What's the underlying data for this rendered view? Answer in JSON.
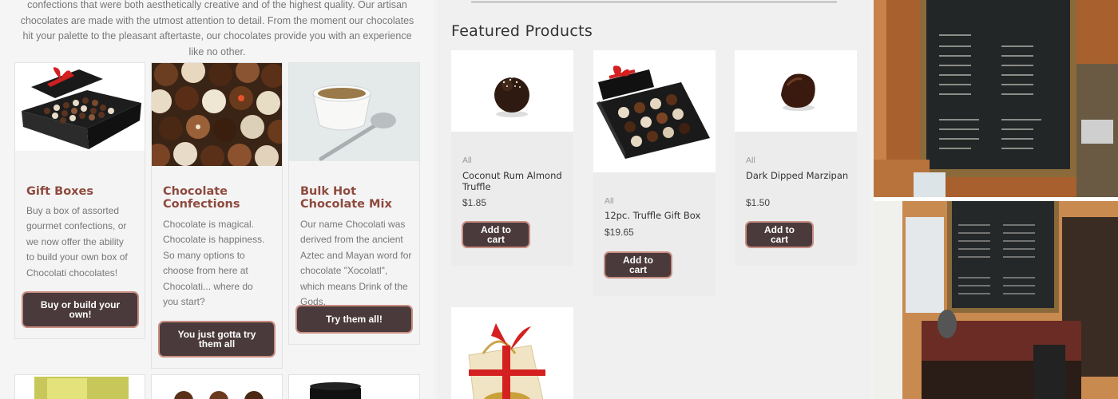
{
  "intro": {
    "text": "confections that were both aesthetically creative and of the highest quality. Our artisan chocolates are made with the utmost attention to detail. From the moment our chocolates hit your palette to the pleasant aftertaste, our chocolates provide you with an experience like no other."
  },
  "categories": [
    {
      "title": "Gift Boxes",
      "description": "Buy a box of assorted gourmet confections, or we now offer the ability to build your own box of Chocolati chocolates!",
      "button": "Buy or build your own!"
    },
    {
      "title": "Chocolate Confections",
      "description": "Chocolate is magical. Chocolate is happiness. So many options to choose from here at Chocolati... where do you start?",
      "button": "You just gotta try them all"
    },
    {
      "title": "Bulk Hot Chocolate Mix",
      "description": "Our name Chocolati was derived from the ancient Aztec and Mayan word for chocolate \"Xocolatl\", which means Drink of the Gods.",
      "button": "Try them all!"
    }
  ],
  "featured": {
    "heading": "Featured Products",
    "products": [
      {
        "category": "All",
        "name": "Coconut Rum Almond Truffle",
        "price": "$1.85",
        "button": "Add to cart"
      },
      {
        "category": "All",
        "name": "12pc. Truffle Gift Box",
        "price": "$19.65",
        "button": "Add to cart"
      },
      {
        "category": "All",
        "name": "Dark Dipped Marzipan",
        "price": "$1.50",
        "button": "Add to cart"
      }
    ]
  },
  "colors": {
    "accent": "#8e4a3e",
    "button_bg": "#4a3a3c",
    "button_ring": "#c98e82"
  }
}
